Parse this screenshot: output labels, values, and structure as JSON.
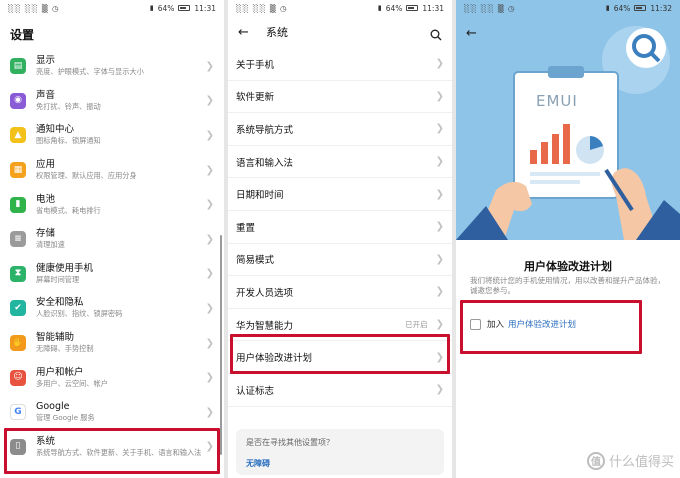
{
  "status_left": "░░ ░░ ▒ ◷",
  "panel1": {
    "time": "11:31",
    "battery": "64%",
    "title": "设置",
    "items": [
      {
        "title": "显示",
        "sub": "亮度、护眼模式、字体与显示大小",
        "color": "#31b060",
        "glyph": "▤"
      },
      {
        "title": "声音",
        "sub": "免打扰、铃声、振动",
        "color": "#8a5bd6",
        "glyph": "◉"
      },
      {
        "title": "通知中心",
        "sub": "图标角标、锁屏通知",
        "color": "#f2c21b",
        "glyph": "▲"
      },
      {
        "title": "应用",
        "sub": "权限管理、默认应用、应用分身",
        "color": "#f4a21d",
        "glyph": "▦"
      },
      {
        "title": "电池",
        "sub": "省电模式、耗电排行",
        "color": "#2fb34a",
        "glyph": "▮"
      },
      {
        "title": "存储",
        "sub": "清理加速",
        "color": "#9b9b9b",
        "glyph": "≡"
      },
      {
        "title": "健康使用手机",
        "sub": "屏幕时间管理",
        "color": "#2bb36a",
        "glyph": "⧗"
      },
      {
        "title": "安全和隐私",
        "sub": "人脸识别、指纹、锁屏密码",
        "color": "#22b5a0",
        "glyph": "✔"
      },
      {
        "title": "智能辅助",
        "sub": "无障碍、手势控制",
        "color": "#f39a1c",
        "glyph": "✋"
      },
      {
        "title": "用户和帐户",
        "sub": "多用户、云空间、帐户",
        "color": "#e8533f",
        "glyph": "☺"
      },
      {
        "title": "Google",
        "sub": "管理 Google 服务",
        "color": "#ffffff",
        "glyph": "G"
      },
      {
        "title": "系统",
        "sub": "系统导航方式、软件更新、关于手机、语言和输入法",
        "color": "#8c8c8c",
        "glyph": "▯"
      }
    ]
  },
  "panel2": {
    "time": "11:31",
    "battery": "64%",
    "title": "系统",
    "items": [
      {
        "label": "关于手机",
        "value": ""
      },
      {
        "label": "软件更新",
        "value": ""
      },
      {
        "label": "系统导航方式",
        "value": ""
      },
      {
        "label": "语言和输入法",
        "value": ""
      },
      {
        "label": "日期和时间",
        "value": ""
      },
      {
        "label": "重置",
        "value": ""
      },
      {
        "label": "简易模式",
        "value": ""
      },
      {
        "label": "开发人员选项",
        "value": ""
      },
      {
        "label": "华为智慧能力",
        "value": "已开启"
      },
      {
        "label": "用户体验改进计划",
        "value": ""
      },
      {
        "label": "认证标志",
        "value": ""
      }
    ],
    "help_question": "是否在寻找其他设置项？",
    "help_link": "无障碍"
  },
  "panel3": {
    "time": "11:32",
    "battery": "64%",
    "logo_text": "EMUI",
    "title": "用户体验改进计划",
    "description": "我们将统计您的手机使用情况，用以改善和提升产品体验，诚邀您参与。",
    "join_label": "加入",
    "join_link": "用户体验改进计划"
  },
  "watermark": {
    "badge": "值",
    "text": "什么值得买"
  },
  "colors": {
    "highlight": "#c8102e",
    "link": "#2a6fbf",
    "hero_bg": "#8ec4e8"
  }
}
